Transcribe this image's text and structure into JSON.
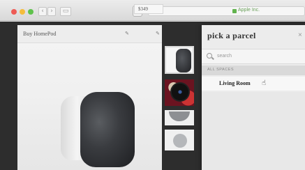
{
  "browser": {
    "address": "Apple Inc.",
    "nav_back": "‹",
    "nav_forward": "›",
    "share_glyph": "⇧"
  },
  "product": {
    "title": "Buy HomePod",
    "price": "$349"
  },
  "overlay": {
    "title": "pick a parcel",
    "close": "×",
    "search_placeholder": "search",
    "section_label": "ALL SPACES",
    "item": "Living Room"
  },
  "icons": [
    "search-icon",
    "share-icon",
    "lock-icon",
    "edit-icon",
    "cursor-icon"
  ],
  "colors": {
    "close": "#ee5b55",
    "minimize": "#f5bd3c",
    "zoom": "#5fc24c",
    "secure": "#62b34e"
  }
}
